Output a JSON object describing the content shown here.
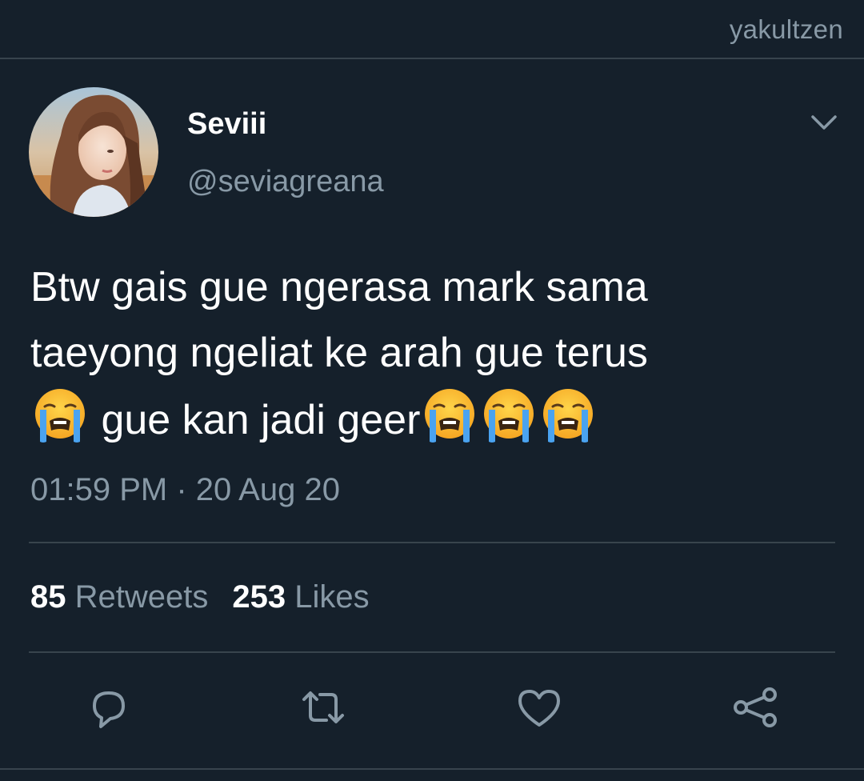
{
  "watermark": "yakultzen",
  "tweet": {
    "display_name": "Seviii",
    "handle": "@seviagreana",
    "text_line1": "Btw gais gue ngerasa mark sama",
    "text_line2": "taeyong ngeliat ke arah gue terus",
    "text_line3_a": "gue kan jadi geer",
    "emoji": "loudly-crying-face-emoji",
    "timestamp": "01:59 PM · 20 Aug 20"
  },
  "stats": {
    "retweets_count": "85",
    "retweets_label": "Retweets",
    "likes_count": "253",
    "likes_label": "Likes"
  },
  "actions": [
    "reply-icon",
    "retweet-icon",
    "like-icon",
    "share-icon"
  ],
  "colors": {
    "background": "#15202b",
    "secondary_text": "#8899a6",
    "divider": "#38444d"
  }
}
